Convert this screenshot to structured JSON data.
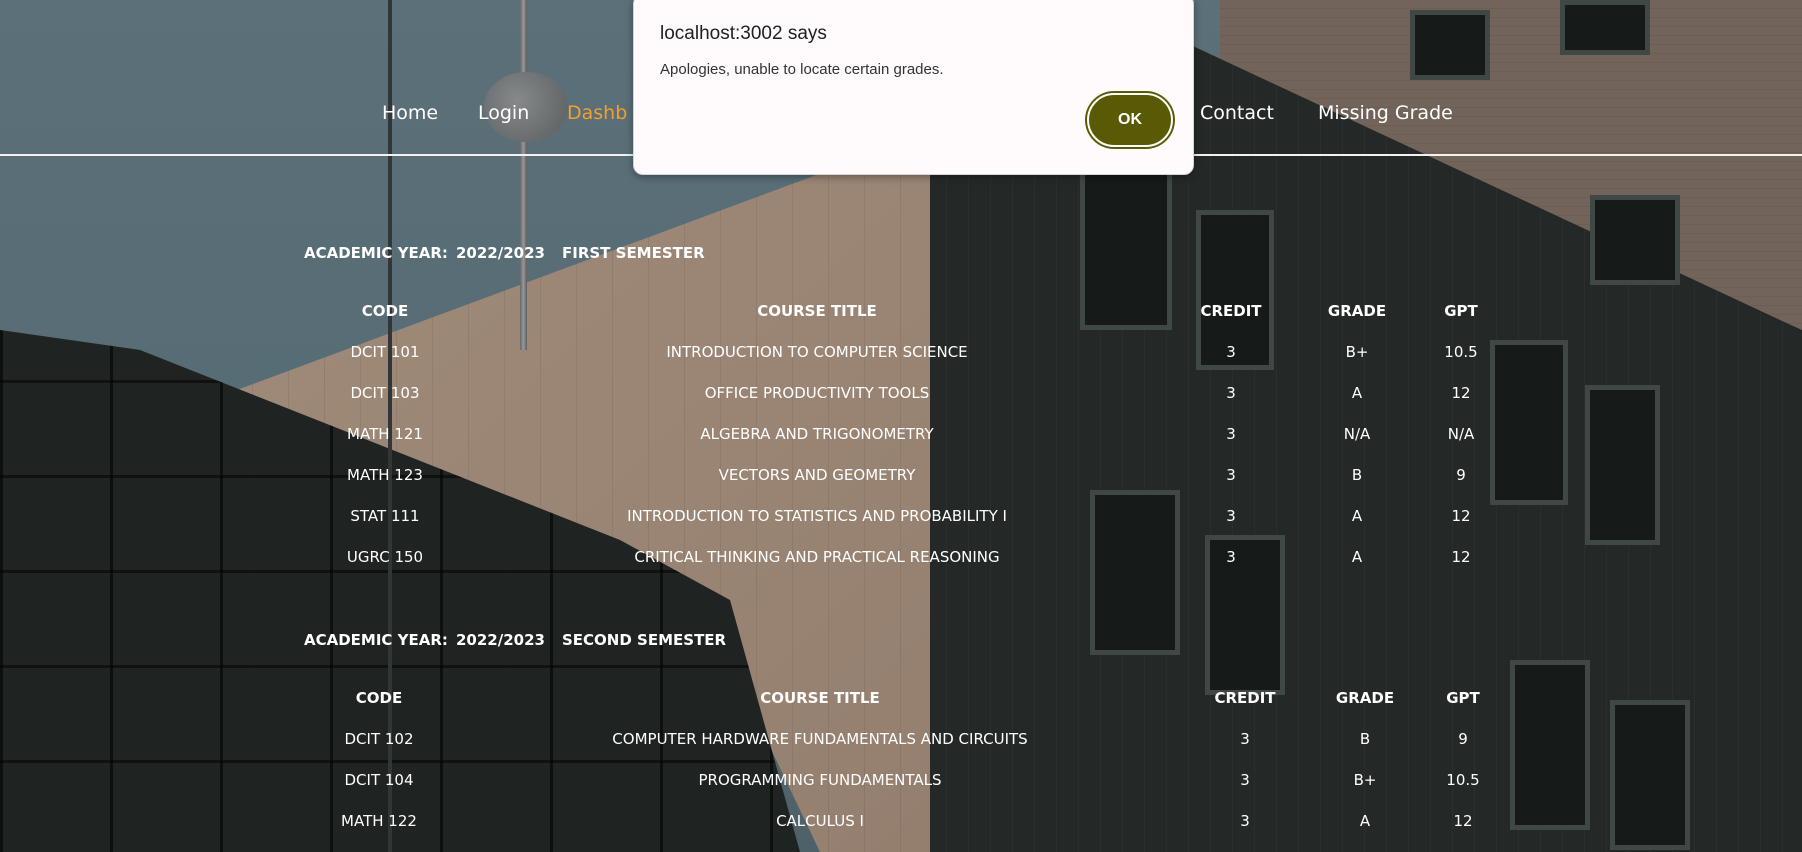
{
  "nav": {
    "items": [
      {
        "label": "Home",
        "active": false
      },
      {
        "label": "Login",
        "active": false
      },
      {
        "label": "Dashb",
        "active": true
      },
      {
        "label": "Contact",
        "active": false
      },
      {
        "label": "Missing Grade",
        "active": false
      }
    ]
  },
  "dialog": {
    "title": "localhost:3002 says",
    "message": "Apologies, unable to locate certain grades.",
    "ok_label": "OK"
  },
  "transcript": {
    "columns": [
      "CODE",
      "COURSE TITLE",
      "CREDIT",
      "GRADE",
      "GPT"
    ],
    "semesters": [
      {
        "year_label": "ACADEMIC YEAR:",
        "year": "2022/2023",
        "semester": "FIRST SEMESTER",
        "rows": [
          [
            "DCIT 101",
            "INTRODUCTION TO COMPUTER SCIENCE",
            "3",
            "B+",
            "10.5"
          ],
          [
            "DCIT 103",
            "OFFICE PRODUCTIVITY TOOLS",
            "3",
            "A",
            "12"
          ],
          [
            "MATH 121",
            "ALGEBRA AND TRIGONOMETRY",
            "3",
            "N/A",
            "N/A"
          ],
          [
            "MATH 123",
            "VECTORS AND GEOMETRY",
            "3",
            "B",
            "9"
          ],
          [
            "STAT 111",
            "INTRODUCTION TO STATISTICS AND PROBABILITY I",
            "3",
            "A",
            "12"
          ],
          [
            "UGRC 150",
            "CRITICAL THINKING AND PRACTICAL REASONING",
            "3",
            "A",
            "12"
          ]
        ]
      },
      {
        "year_label": "ACADEMIC YEAR:",
        "year": "2022/2023",
        "semester": "SECOND SEMESTER",
        "rows": [
          [
            "DCIT 102",
            "COMPUTER HARDWARE FUNDAMENTALS AND CIRCUITS",
            "3",
            "B",
            "9"
          ],
          [
            "DCIT 104",
            "PROGRAMMING FUNDAMENTALS",
            "3",
            "B+",
            "10.5"
          ],
          [
            "MATH 122",
            "CALCULUS I",
            "3",
            "A",
            "12"
          ]
        ]
      }
    ]
  },
  "colors": {
    "nav_active": "#f2a02b",
    "ok_button": "#5a5a06",
    "dialog_bg": "#fffbfd"
  }
}
